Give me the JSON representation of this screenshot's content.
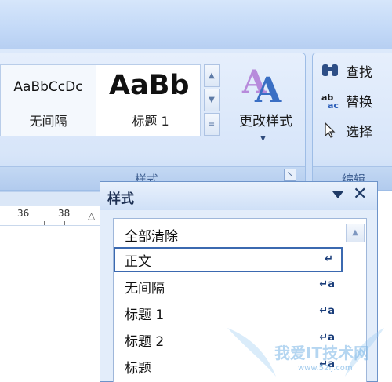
{
  "ribbon": {
    "styles_group": {
      "label": "样式",
      "gallery": [
        {
          "sample": "AaBbCcDc",
          "name": "无间隔"
        },
        {
          "sample": "AaBb",
          "name": "标题 1"
        }
      ],
      "change_styles_label": "更改样式"
    },
    "edit_group": {
      "label": "编辑",
      "items": [
        {
          "label": "查找",
          "icon": "binoculars-icon"
        },
        {
          "label": "替换",
          "icon": "replace-icon"
        },
        {
          "label": "选择",
          "icon": "cursor-icon"
        }
      ]
    }
  },
  "ruler": {
    "numbers": [
      "36",
      "38"
    ]
  },
  "styles_pane": {
    "title": "样式",
    "items": [
      {
        "label": "全部清除",
        "mark": "",
        "selected": false
      },
      {
        "label": "正文",
        "mark": "↵",
        "selected": true
      },
      {
        "label": "无间隔",
        "mark": "↵a",
        "selected": false
      },
      {
        "label": "标题 1",
        "mark": "↵a",
        "selected": false
      },
      {
        "label": "标题 2",
        "mark": "↵a",
        "selected": false
      },
      {
        "label": "标题",
        "mark": "↵a",
        "selected": false
      }
    ]
  },
  "watermark": {
    "text": "我爱IT技术网",
    "sub": "www.52ij.com"
  },
  "colors": {
    "accent": "#3b69b0",
    "ribbon": "#cfe0f8",
    "pane_border": "#6d93c9"
  }
}
